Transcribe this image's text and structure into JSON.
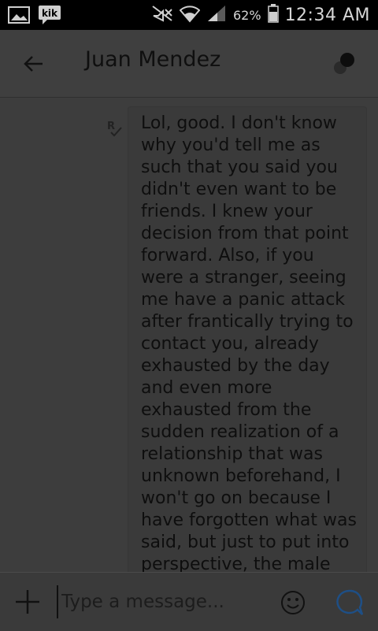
{
  "status_bar": {
    "battery_percent": "62%",
    "time": "12:34 AM",
    "icons": [
      "image-icon",
      "kik-icon",
      "mute-icon",
      "wifi-icon",
      "signal-icon",
      "battery-icon"
    ],
    "kik_label": "kik"
  },
  "header": {
    "title": "Juan Mendez",
    "back_icon": "arrow-left-icon",
    "menu_icon": "options-dots-icon"
  },
  "message": {
    "read_indicator": "read-receipt-icon",
    "text": "Lol, good. I don't know\nwhy you'd tell me as\nsuch that you said you\ndidn't even want to be\nfriends. I knew your\ndecision from that point\nforward. Also, if you\nwere a stranger, seeing\nme have a panic attack\nafter frantically trying to\ncontact you, already\nexhausted by the day\nand even more\nexhausted from the\nsudden realization of a\nrelationship that was\nunknown beforehand, I\nwon't go on because I\nhave forgotten what was\nsaid, but just to put into\nperspective, the male"
  },
  "input_bar": {
    "placeholder": "Type a message...",
    "value": "",
    "accent_color": "#1e4f86"
  }
}
